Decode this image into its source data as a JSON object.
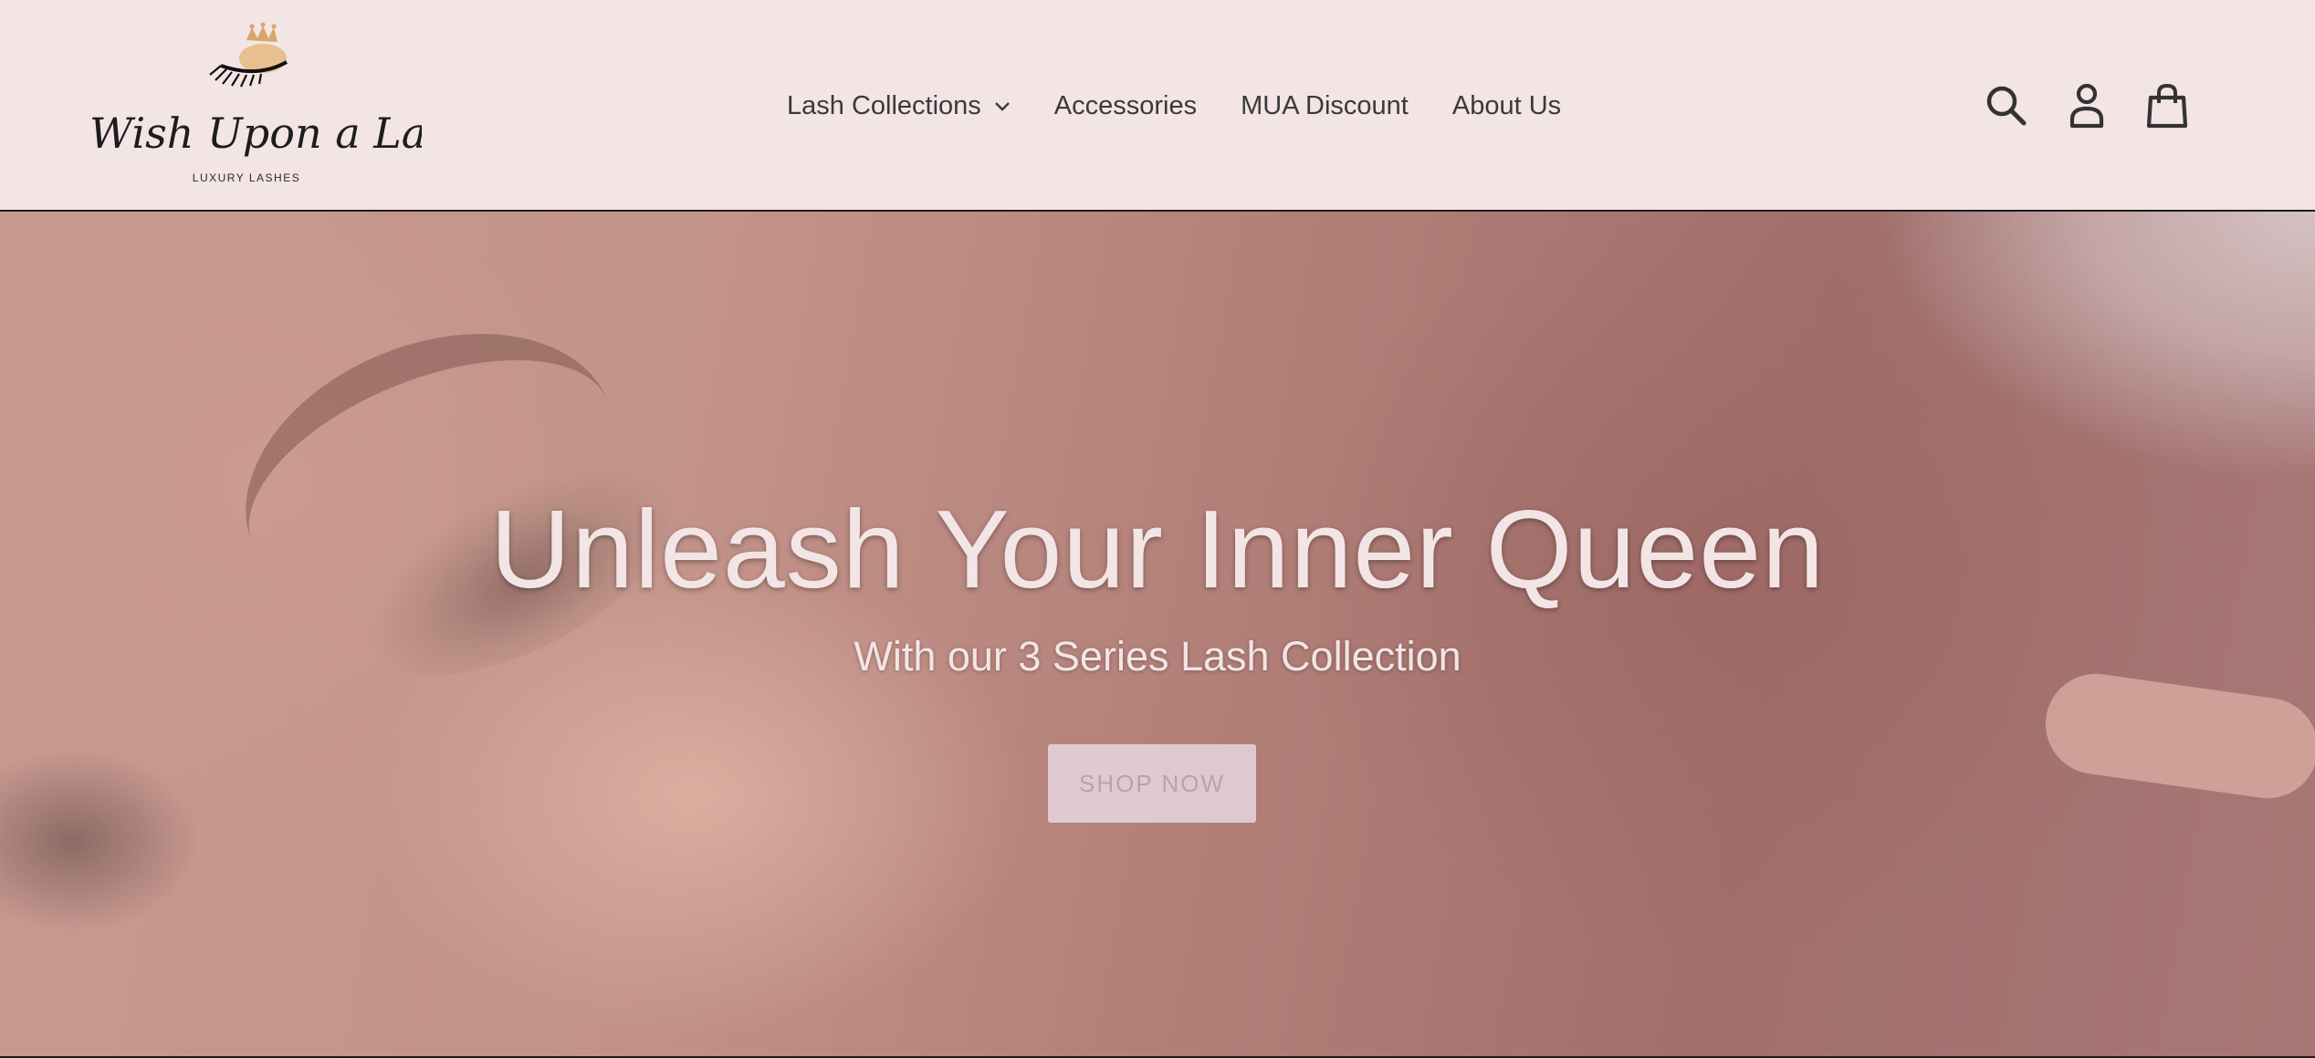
{
  "logo": {
    "script_text": "Wish Upon a Lash",
    "subtitle": "LUXURY LASHES",
    "icon": "lash-crown-icon"
  },
  "nav": {
    "items": [
      {
        "label": "Lash Collections",
        "has_dropdown": true
      },
      {
        "label": "Accessories"
      },
      {
        "label": "MUA Discount"
      },
      {
        "label": "About Us"
      }
    ]
  },
  "header_icons": [
    "search-icon",
    "account-icon",
    "cart-icon"
  ],
  "hero": {
    "title": "Unleash Your Inner Queen",
    "subtitle": "With our 3 Series Lash Collection",
    "cta_label": "SHOP NOW"
  },
  "colors": {
    "header_bg": "#f3e4e6",
    "text_dark": "#3a3a3a",
    "hero_text": "#f3e4e6",
    "button_bg": "#e2d0d6",
    "button_text": "#b9a3ab"
  }
}
